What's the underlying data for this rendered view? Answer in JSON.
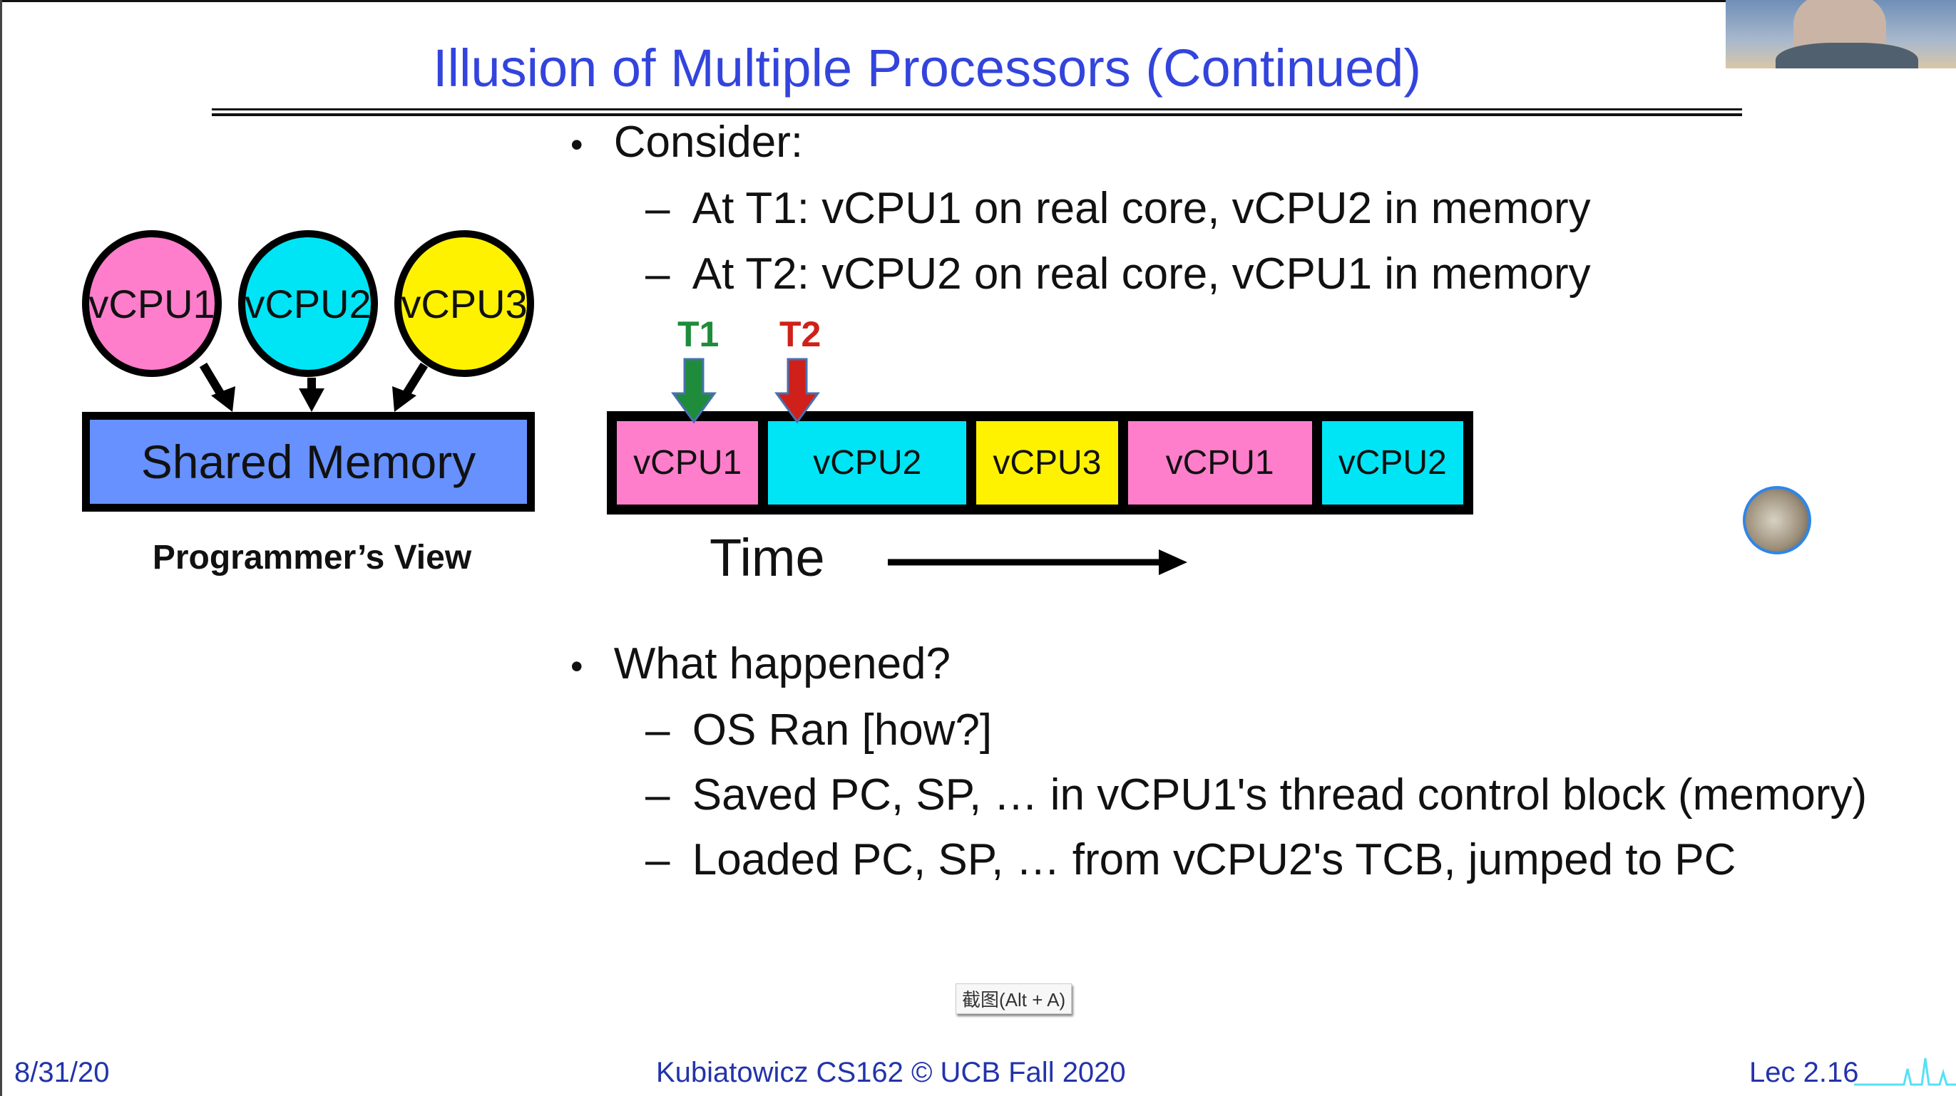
{
  "slide": {
    "title": "Illusion of Multiple Processors (Continued)",
    "bullets": [
      {
        "text": "Consider:",
        "subs": [
          "At T1: vCPU1 on real core, vCPU2 in memory",
          "At T2: vCPU2 on real core, vCPU1 in memory"
        ]
      },
      {
        "text": "What happened?",
        "subs": [
          "OS Ran [how?]",
          "Saved PC, SP, … in vCPU1's thread control block (memory)",
          "Loaded PC, SP, … from vCPU2's TCB, jumped to PC"
        ]
      }
    ],
    "bullet_glyph": "•",
    "dash_glyph": "–"
  },
  "programmers_view": {
    "cpus": [
      {
        "label": "vCPU1",
        "color": "#ff7ecb"
      },
      {
        "label": "vCPU2",
        "color": "#00e5f5"
      },
      {
        "label": "vCPU3",
        "color": "#fff200"
      }
    ],
    "memory_label": "Shared Memory",
    "memory_color": "#6691ff",
    "caption": "Programmer’s View"
  },
  "timeline": {
    "segments": [
      {
        "label": "vCPU1",
        "color": "#ff7ecb",
        "duration": 1.0
      },
      {
        "label": "vCPU2",
        "color": "#00e5f5",
        "duration": 1.4
      },
      {
        "label": "vCPU3",
        "color": "#fff200",
        "duration": 1.0
      },
      {
        "label": "vCPU1",
        "color": "#ff7ecb",
        "duration": 1.3
      },
      {
        "label": "vCPU2",
        "color": "#00e5f5",
        "duration": 1.0
      }
    ],
    "markers": [
      {
        "label": "T1",
        "color": "#1e8c3a"
      },
      {
        "label": "T2",
        "color": "#d0201a"
      }
    ],
    "time_label": "Time"
  },
  "footer": {
    "date": "8/31/20",
    "center": "Kubiatowicz CS162 © UCB Fall 2020",
    "page": "Lec 2.16"
  },
  "overlay": {
    "tooltip": "截图(Alt + A)"
  },
  "colors": {
    "title": "#3344dd",
    "footer": "#2233aa",
    "avatar_ring": "#2f86e8"
  }
}
